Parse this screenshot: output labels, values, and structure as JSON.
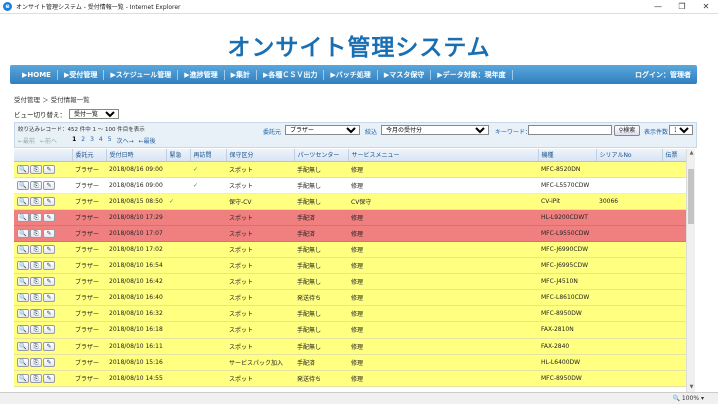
{
  "window": {
    "title": "オンサイト管理システム - 受付情報一覧 - Internet Explorer",
    "browser_icon": "e"
  },
  "header": {
    "title": "オンサイト管理システム"
  },
  "nav": {
    "items": [
      "▶HOME",
      "▶受付管理",
      "▶スケジュール管理",
      "▶進捗管理",
      "▶集計",
      "▶各種ＣＳＶ出力",
      "▶バッチ処理",
      "▶マスタ保守",
      "▶データ対象：現年度"
    ],
    "login": "ログイン：管理者"
  },
  "breadcrumb": "受付管理 ＞ 受付情報一覧",
  "view_switch": {
    "label": "ビュー切り替え：",
    "selected": "受付一覧"
  },
  "filter": {
    "record_info": "絞り込みレコード：452 件中 1 ～ 100 件目を表示",
    "pager": {
      "first": "←最前",
      "prev": "←前へ",
      "pages": [
        "1",
        "2",
        "3",
        "4",
        "5"
      ],
      "next": "次へ→",
      "last": "←最後"
    },
    "client_label": "委託元",
    "client_value": "ブラザー",
    "period_label": "絞込",
    "period_value": "今月の受付分",
    "keyword_label": "キーワード：",
    "keyword_value": "",
    "search_label": "検索",
    "count_label": "表示件数",
    "count_value": "100"
  },
  "table": {
    "headers": [
      "",
      "委託元",
      "受付日時",
      "緊急",
      "再訪問",
      "保守区分",
      "パーツセンター",
      "サービスメニュー",
      "機種",
      "シリアルNo",
      "伝票"
    ],
    "action_icons": [
      "🔍",
      "⎘",
      "✎"
    ],
    "rows": [
      {
        "status": "yellow",
        "client": "ブラザー",
        "date": "2018/08/16 09:00",
        "urgent": "",
        "revisit": "✓",
        "maint": "スポット",
        "parts": "手配無し",
        "menu": "修理",
        "model": "MFC-8520DN",
        "serial": "",
        "slip": ""
      },
      {
        "status": "white",
        "client": "ブラザー",
        "date": "2018/08/16 09:00",
        "urgent": "",
        "revisit": "✓",
        "maint": "スポット",
        "parts": "手配無し",
        "menu": "修理",
        "model": "MFC-L5570CDW",
        "serial": "",
        "slip": ""
      },
      {
        "status": "yellow",
        "client": "ブラザー",
        "date": "2018/08/15 08:50",
        "urgent": "✓",
        "revisit": "",
        "maint": "保守-CV",
        "parts": "手配無し",
        "menu": "CV保守",
        "model": "CV-iPit",
        "serial": "30066",
        "slip": ""
      },
      {
        "status": "red",
        "client": "ブラザー",
        "date": "2018/08/10 17:29",
        "urgent": "",
        "revisit": "",
        "maint": "スポット",
        "parts": "手配済",
        "menu": "修理",
        "model": "HL-L9200CDWT",
        "serial": "",
        "slip": ""
      },
      {
        "status": "red",
        "client": "ブラザー",
        "date": "2018/08/10 17:07",
        "urgent": "",
        "revisit": "",
        "maint": "スポット",
        "parts": "手配済",
        "menu": "修理",
        "model": "MFC-L9550CDW",
        "serial": "",
        "slip": ""
      },
      {
        "status": "yellow",
        "client": "ブラザー",
        "date": "2018/08/10 17:02",
        "urgent": "",
        "revisit": "",
        "maint": "スポット",
        "parts": "手配無し",
        "menu": "修理",
        "model": "MFC-J6990CDW",
        "serial": "",
        "slip": ""
      },
      {
        "status": "yellow",
        "client": "ブラザー",
        "date": "2018/08/10 16:54",
        "urgent": "",
        "revisit": "",
        "maint": "スポット",
        "parts": "手配無し",
        "menu": "修理",
        "model": "MFC-J6995CDW",
        "serial": "",
        "slip": ""
      },
      {
        "status": "yellow",
        "client": "ブラザー",
        "date": "2018/08/10 16:42",
        "urgent": "",
        "revisit": "",
        "maint": "スポット",
        "parts": "手配無し",
        "menu": "修理",
        "model": "MFC-J4510N",
        "serial": "",
        "slip": ""
      },
      {
        "status": "yellow",
        "client": "ブラザー",
        "date": "2018/08/10 16:40",
        "urgent": "",
        "revisit": "",
        "maint": "スポット",
        "parts": "発送待ち",
        "menu": "修理",
        "model": "MFC-L8610CDW",
        "serial": "",
        "slip": ""
      },
      {
        "status": "yellow",
        "client": "ブラザー",
        "date": "2018/08/10 16:32",
        "urgent": "",
        "revisit": "",
        "maint": "スポット",
        "parts": "手配無し",
        "menu": "修理",
        "model": "MFC-8950DW",
        "serial": "",
        "slip": ""
      },
      {
        "status": "yellow",
        "client": "ブラザー",
        "date": "2018/08/10 16:18",
        "urgent": "",
        "revisit": "",
        "maint": "スポット",
        "parts": "手配無し",
        "menu": "修理",
        "model": "FAX-2810N",
        "serial": "",
        "slip": ""
      },
      {
        "status": "yellow",
        "client": "ブラザー",
        "date": "2018/08/10 16:11",
        "urgent": "",
        "revisit": "",
        "maint": "スポット",
        "parts": "手配無し",
        "menu": "修理",
        "model": "FAX-2840",
        "serial": "",
        "slip": ""
      },
      {
        "status": "yellow",
        "client": "ブラザー",
        "date": "2018/08/10 15:16",
        "urgent": "",
        "revisit": "",
        "maint": "サービスパック加入",
        "parts": "手配済",
        "menu": "修理",
        "model": "HL-L6400DW",
        "serial": "",
        "slip": ""
      },
      {
        "status": "yellow",
        "client": "ブラザー",
        "date": "2018/08/10 14:55",
        "urgent": "",
        "revisit": "",
        "maint": "スポット",
        "parts": "発送待ち",
        "menu": "修理",
        "model": "MFC-8950DW",
        "serial": "",
        "slip": ""
      }
    ]
  },
  "statusbar": {
    "zoom": "🔍 100%  ▾"
  }
}
